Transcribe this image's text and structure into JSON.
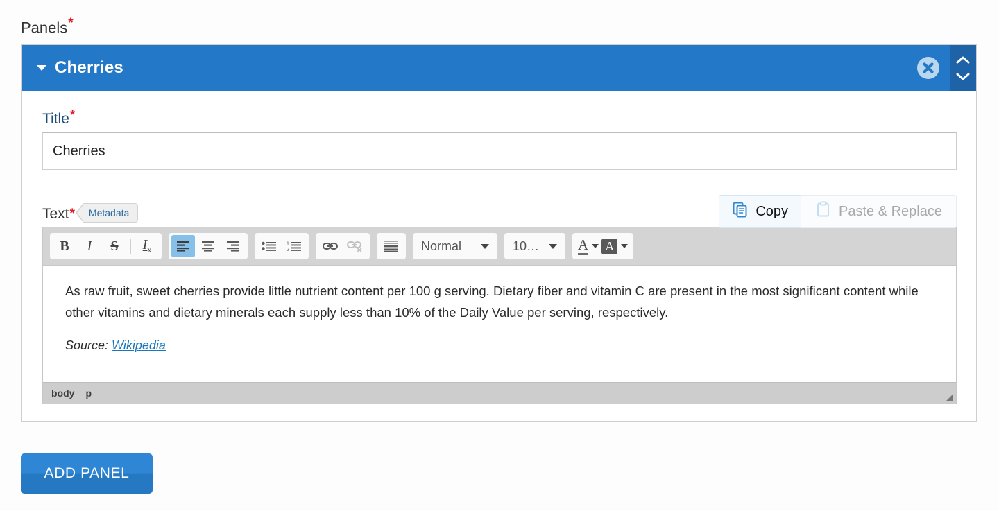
{
  "form": {
    "panels_label": "Panels",
    "required_marker": "*"
  },
  "panel": {
    "header_title": "Cherries",
    "collapse_icon": "caret-down-icon",
    "remove_icon": "remove-circle-icon",
    "move_up_icon": "chevron-up-icon",
    "move_down_icon": "chevron-down-icon",
    "title_field": {
      "label": "Title",
      "value": "Cherries"
    },
    "text_field": {
      "label": "Text",
      "metadata_badge": "Metadata",
      "copy_label": "Copy",
      "copy_icon": "copy-icon",
      "paste_label": "Paste & Replace",
      "paste_icon": "paste-icon"
    }
  },
  "editor": {
    "toolbar": {
      "bold": "B",
      "italic": "I",
      "strike": "S",
      "remove_format": "Tx",
      "align_left_icon": "align-left-icon",
      "align_center_icon": "align-center-icon",
      "align_right_icon": "align-right-icon",
      "bullet_list_icon": "bulleted-list-icon",
      "numbered_list_icon": "numbered-list-icon",
      "link_icon": "link-icon",
      "unlink_icon": "unlink-icon",
      "horizontal_rule_icon": "horizontal-rule-icon",
      "paragraph_format": "Normal",
      "font_size": "10…",
      "text_color_icon": "text-color-icon",
      "background_color_icon": "background-color-icon"
    },
    "content": {
      "paragraph1": "As raw fruit, sweet cherries provide little nutrient content per 100 g serving. Dietary fiber and vitamin C are present in the most significant content while other vitamins and dietary minerals each supply less than 10% of the Daily Value per serving, respectively.",
      "source_prefix": "Source: ",
      "source_link": "Wikipedia"
    },
    "element_path": {
      "item1": "body",
      "item2": "p"
    }
  },
  "actions": {
    "add_panel_label": "ADD PANEL"
  },
  "colors": {
    "header_blue": "#2478c8",
    "order_strip_blue": "#1e62a8",
    "label_blue": "#1f4e79",
    "required_red": "#e31b23",
    "link_blue": "#1b76bc",
    "toolbar_gray": "#d4d4d4",
    "active_toolbar_blue": "#86c0e8",
    "button_blue": "#2f86d4"
  }
}
